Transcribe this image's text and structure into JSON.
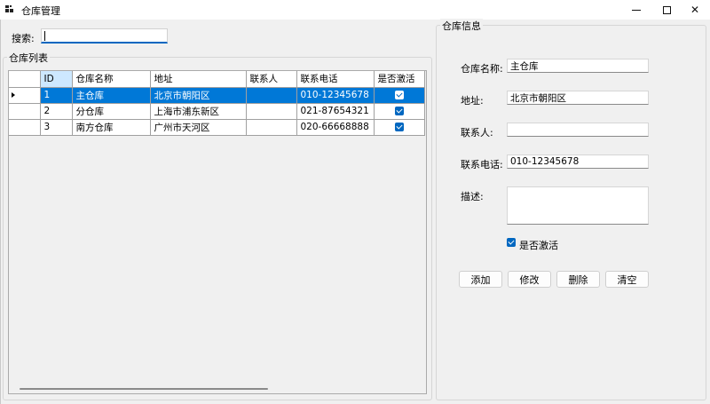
{
  "window": {
    "title": "仓库管理"
  },
  "search": {
    "label": "搜索:",
    "value": ""
  },
  "list_group": {
    "legend": "仓库列表"
  },
  "table": {
    "columns": [
      "ID",
      "仓库名称",
      "地址",
      "联系人",
      "联系电话",
      "是否激活"
    ],
    "rows": [
      {
        "id": "1",
        "name": "主仓库",
        "address": "北京市朝阳区",
        "contact": "",
        "phone": "010-12345678",
        "active": true
      },
      {
        "id": "2",
        "name": "分仓库",
        "address": "上海市浦东新区",
        "contact": "",
        "phone": "021-87654321",
        "active": true
      },
      {
        "id": "3",
        "name": "南方仓库",
        "address": "广州市天河区",
        "contact": "",
        "phone": "020-66668888",
        "active": true
      }
    ],
    "selected_row": 0
  },
  "info_group": {
    "legend": "仓库信息",
    "name_label": "仓库名称:",
    "name_value": "主仓库",
    "address_label": "地址:",
    "address_value": "北京市朝阳区",
    "contact_label": "联系人:",
    "contact_value": "",
    "phone_label": "联系电话:",
    "phone_value": "010-12345678",
    "desc_label": "描述:",
    "desc_value": "",
    "active_label": "是否激活",
    "active_checked": true
  },
  "buttons": {
    "add": "添加",
    "edit": "修改",
    "delete": "删除",
    "clear": "清空"
  },
  "colors": {
    "accent": "#0067c0",
    "selection": "#0078d7",
    "header_selected": "#cde8ff"
  }
}
